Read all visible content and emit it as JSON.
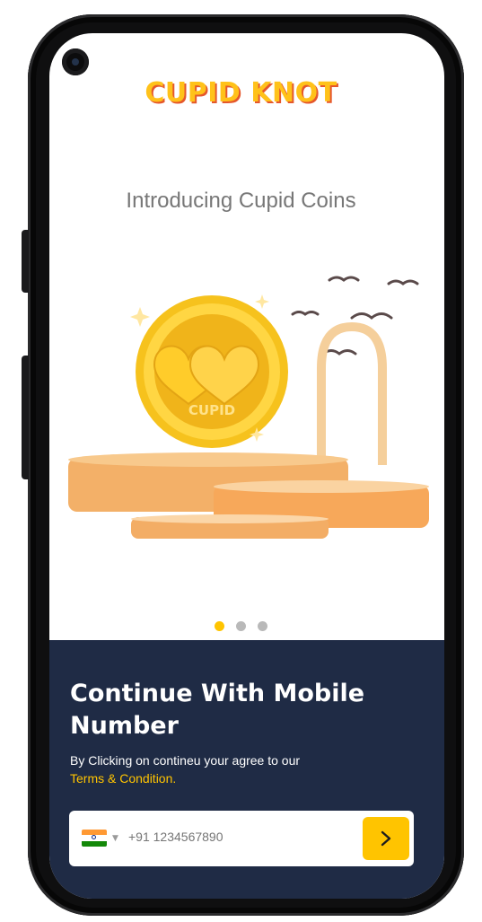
{
  "brand": {
    "name": "CUPID KNOT",
    "accent": "#ffc21a",
    "shadow": "#e5572c"
  },
  "intro": {
    "title": "Introducing Cupid Coins"
  },
  "illustration": {
    "coin_text": "CUPID"
  },
  "carousel": {
    "pages": 3,
    "active": 1,
    "active_color": "#ffc400"
  },
  "login": {
    "heading": "Continue With Mobile Number",
    "subtext": "By Clicking on contineu your agree to our",
    "terms_link": "Terms & Condition.",
    "phone_placeholder": "+91 1234567890",
    "country_flag": "india-flag-icon",
    "submit_icon": "chevron-right-icon",
    "panel_color": "#1f2b45"
  }
}
